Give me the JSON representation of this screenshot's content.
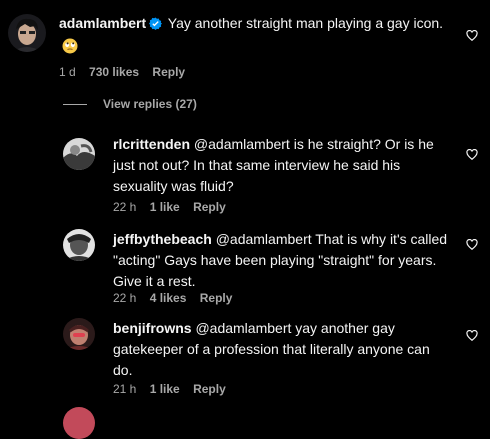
{
  "main_comment": {
    "username": "adamlambert",
    "verified_icon": "verified-badge-icon",
    "text": "Yay another straight man playing a gay icon.",
    "emoji_icon": "rolling-eyes-emoji-icon",
    "time": "1 d",
    "likes": "730 likes",
    "reply_label": "Reply"
  },
  "view_replies": {
    "label": "View replies (27)"
  },
  "replies": [
    {
      "username": "rlcrittenden",
      "text": "@adamlambert is he straight? Or is he just not out? In that same interview he said his sexuality was fluid?",
      "time": "22 h",
      "likes": "1 like",
      "reply_label": "Reply"
    },
    {
      "username": "jeffbythebeach",
      "text": "@adamlambert That is why it's called \"acting\" Gays have been playing \"straight\" for years. Give it a rest.",
      "time": "22 h",
      "likes": "4 likes",
      "reply_label": "Reply"
    },
    {
      "username": "benjifrowns",
      "text": "@adamlambert yay another gay gatekeeper of a profession that literally anyone can do.",
      "time": "21 h",
      "likes": "1 like",
      "reply_label": "Reply"
    }
  ],
  "icons": {
    "like": "heart-outline-icon"
  },
  "colors": {
    "background": "#000000",
    "text": "#f5f5f5",
    "secondary": "#a8a8a8",
    "verified": "#0095f6"
  }
}
